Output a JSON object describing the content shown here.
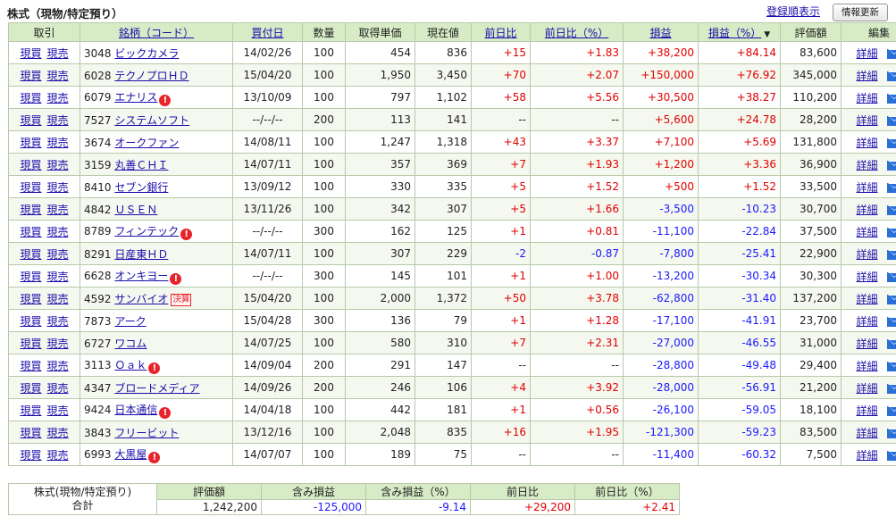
{
  "header": {
    "title": "株式（現物/特定預り）",
    "order_link": "登録順表示",
    "refresh_button": "情報更新"
  },
  "columns": {
    "trade": "取引",
    "name": "銘柄（コード）",
    "buy_date": "買付日",
    "qty": "数量",
    "cost": "取得単価",
    "price": "現在値",
    "change": "前日比",
    "change_pct": "前日比（%）",
    "pl": "損益",
    "pl_pct": "損益（%）",
    "sort_mark": "▼",
    "value": "評価額",
    "edit": "編集"
  },
  "labels": {
    "buy": "現買",
    "sell": "現売",
    "detail": "詳細",
    "settle_badge": "決算",
    "warn_mark": "!"
  },
  "rows": [
    {
      "code": "3048",
      "name": "ビックカメラ",
      "date": "14/02/26",
      "qty": "100",
      "cost": "454",
      "price": "836",
      "chg": "+15",
      "chgp": "+1.83",
      "pl": "+38,200",
      "plp": "+84.14",
      "val": "83,600",
      "warn": false,
      "badge": false
    },
    {
      "code": "6028",
      "name": "テクノプロＨＤ",
      "date": "15/04/20",
      "qty": "100",
      "cost": "1,950",
      "price": "3,450",
      "chg": "+70",
      "chgp": "+2.07",
      "pl": "+150,000",
      "plp": "+76.92",
      "val": "345,000",
      "warn": false,
      "badge": false
    },
    {
      "code": "6079",
      "name": "エナリス",
      "date": "13/10/09",
      "qty": "100",
      "cost": "797",
      "price": "1,102",
      "chg": "+58",
      "chgp": "+5.56",
      "pl": "+30,500",
      "plp": "+38.27",
      "val": "110,200",
      "warn": true,
      "badge": false
    },
    {
      "code": "7527",
      "name": "システムソフト",
      "date": "--/--/--",
      "qty": "200",
      "cost": "113",
      "price": "141",
      "chg": "--",
      "chgp": "--",
      "pl": "+5,600",
      "plp": "+24.78",
      "val": "28,200",
      "warn": false,
      "badge": false
    },
    {
      "code": "3674",
      "name": "オークファン",
      "date": "14/08/11",
      "qty": "100",
      "cost": "1,247",
      "price": "1,318",
      "chg": "+43",
      "chgp": "+3.37",
      "pl": "+7,100",
      "plp": "+5.69",
      "val": "131,800",
      "warn": false,
      "badge": false
    },
    {
      "code": "3159",
      "name": "丸善ＣＨＩ",
      "date": "14/07/11",
      "qty": "100",
      "cost": "357",
      "price": "369",
      "chg": "+7",
      "chgp": "+1.93",
      "pl": "+1,200",
      "plp": "+3.36",
      "val": "36,900",
      "warn": false,
      "badge": false
    },
    {
      "code": "8410",
      "name": "セブン銀行",
      "date": "13/09/12",
      "qty": "100",
      "cost": "330",
      "price": "335",
      "chg": "+5",
      "chgp": "+1.52",
      "pl": "+500",
      "plp": "+1.52",
      "val": "33,500",
      "warn": false,
      "badge": false
    },
    {
      "code": "4842",
      "name": "ＵＳＥＮ",
      "date": "13/11/26",
      "qty": "100",
      "cost": "342",
      "price": "307",
      "chg": "+5",
      "chgp": "+1.66",
      "pl": "-3,500",
      "plp": "-10.23",
      "val": "30,700",
      "warn": false,
      "badge": false
    },
    {
      "code": "8789",
      "name": "フィンテック",
      "date": "--/--/--",
      "qty": "300",
      "cost": "162",
      "price": "125",
      "chg": "+1",
      "chgp": "+0.81",
      "pl": "-11,100",
      "plp": "-22.84",
      "val": "37,500",
      "warn": true,
      "badge": false
    },
    {
      "code": "8291",
      "name": "日産東ＨＤ",
      "date": "14/07/11",
      "qty": "100",
      "cost": "307",
      "price": "229",
      "chg": "-2",
      "chgp": "-0.87",
      "pl": "-7,800",
      "plp": "-25.41",
      "val": "22,900",
      "warn": false,
      "badge": false
    },
    {
      "code": "6628",
      "name": "オンキヨー",
      "date": "--/--/--",
      "qty": "300",
      "cost": "145",
      "price": "101",
      "chg": "+1",
      "chgp": "+1.00",
      "pl": "-13,200",
      "plp": "-30.34",
      "val": "30,300",
      "warn": true,
      "badge": false
    },
    {
      "code": "4592",
      "name": "サンバイオ",
      "date": "15/04/20",
      "qty": "100",
      "cost": "2,000",
      "price": "1,372",
      "chg": "+50",
      "chgp": "+3.78",
      "pl": "-62,800",
      "plp": "-31.40",
      "val": "137,200",
      "warn": false,
      "badge": true
    },
    {
      "code": "7873",
      "name": "アーク",
      "date": "15/04/28",
      "qty": "300",
      "cost": "136",
      "price": "79",
      "chg": "+1",
      "chgp": "+1.28",
      "pl": "-17,100",
      "plp": "-41.91",
      "val": "23,700",
      "warn": false,
      "badge": false
    },
    {
      "code": "6727",
      "name": "ワコム",
      "date": "14/07/25",
      "qty": "100",
      "cost": "580",
      "price": "310",
      "chg": "+7",
      "chgp": "+2.31",
      "pl": "-27,000",
      "plp": "-46.55",
      "val": "31,000",
      "warn": false,
      "badge": false
    },
    {
      "code": "3113",
      "name": "Ｏａｋ",
      "date": "14/09/04",
      "qty": "200",
      "cost": "291",
      "price": "147",
      "chg": "--",
      "chgp": "--",
      "pl": "-28,800",
      "plp": "-49.48",
      "val": "29,400",
      "warn": true,
      "badge": false
    },
    {
      "code": "4347",
      "name": "ブロードメディア",
      "date": "14/09/26",
      "qty": "200",
      "cost": "246",
      "price": "106",
      "chg": "+4",
      "chgp": "+3.92",
      "pl": "-28,000",
      "plp": "-56.91",
      "val": "21,200",
      "warn": false,
      "badge": false
    },
    {
      "code": "9424",
      "name": "日本通信",
      "date": "14/04/18",
      "qty": "100",
      "cost": "442",
      "price": "181",
      "chg": "+1",
      "chgp": "+0.56",
      "pl": "-26,100",
      "plp": "-59.05",
      "val": "18,100",
      "warn": true,
      "badge": false
    },
    {
      "code": "3843",
      "name": "フリービット",
      "date": "13/12/16",
      "qty": "100",
      "cost": "2,048",
      "price": "835",
      "chg": "+16",
      "chgp": "+1.95",
      "pl": "-121,300",
      "plp": "-59.23",
      "val": "83,500",
      "warn": false,
      "badge": false
    },
    {
      "code": "6993",
      "name": "大黒屋",
      "date": "14/07/07",
      "qty": "100",
      "cost": "189",
      "price": "75",
      "chg": "--",
      "chgp": "--",
      "pl": "-11,400",
      "plp": "-60.32",
      "val": "7,500",
      "warn": true,
      "badge": false
    }
  ],
  "summary": {
    "label_line1": "株式(現物/特定預り)",
    "label_line2": "合計",
    "headers": [
      "評価額",
      "含み損益",
      "含み損益（%）",
      "前日比",
      "前日比（%）"
    ],
    "values": [
      "1,242,200",
      "-125,000",
      "-9.14",
      "+29,200",
      "+2.41"
    ]
  },
  "colors": {
    "header_bg": "#d7ecc6",
    "positive": "#e00000",
    "negative": "#1a1aff",
    "link": "#1a0dab"
  }
}
